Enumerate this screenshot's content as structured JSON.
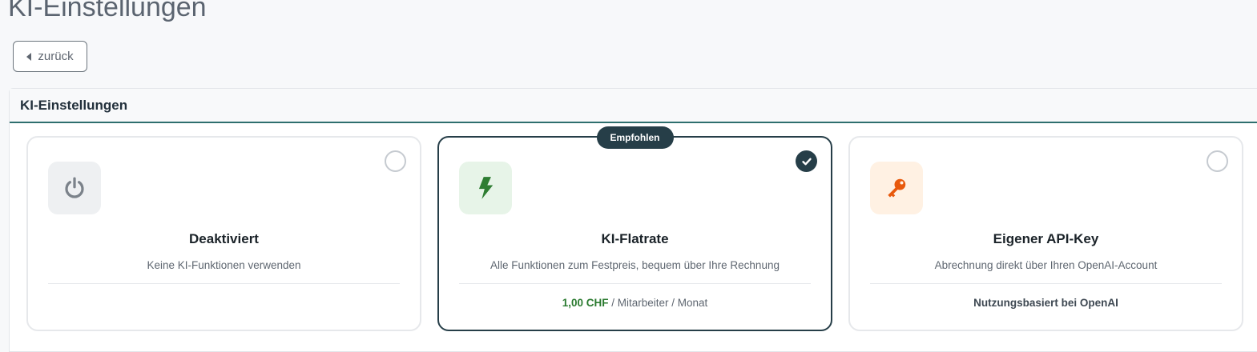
{
  "page": {
    "title": "KI-Einstellungen"
  },
  "back_button": {
    "label": "zurück",
    "icon": "caret-left-icon"
  },
  "panel": {
    "title": "KI-Einstellungen"
  },
  "options": [
    {
      "title": "Deaktiviert",
      "description": "Keine KI-Funktionen verwenden",
      "icon": "power-icon",
      "icon_color": "#7b828a",
      "icon_bg": "#eef0f2",
      "selected": false
    },
    {
      "title": "KI-Flatrate",
      "description": "Alle Funktionen zum Festpreis, bequem über Ihre Rechnung",
      "icon": "bolt-icon",
      "icon_color": "#2e7d32",
      "icon_bg": "#e7f4e8",
      "selected": true,
      "badge": "Empfohlen",
      "price_amount": "1,00 CHF",
      "price_unit": "/ Mitarbeiter / Monat"
    },
    {
      "title": "Eigener API-Key",
      "description": "Abrechnung direkt über Ihren OpenAI-Account",
      "icon": "key-icon",
      "icon_color": "#e8590c",
      "icon_bg": "#fff1e3",
      "selected": false,
      "pricing_note": "Nutzungsbasiert bei OpenAI"
    }
  ],
  "colors": {
    "accent": "#263e48",
    "header_border": "#2e6f6e",
    "price_green": "#2a7a2f"
  }
}
